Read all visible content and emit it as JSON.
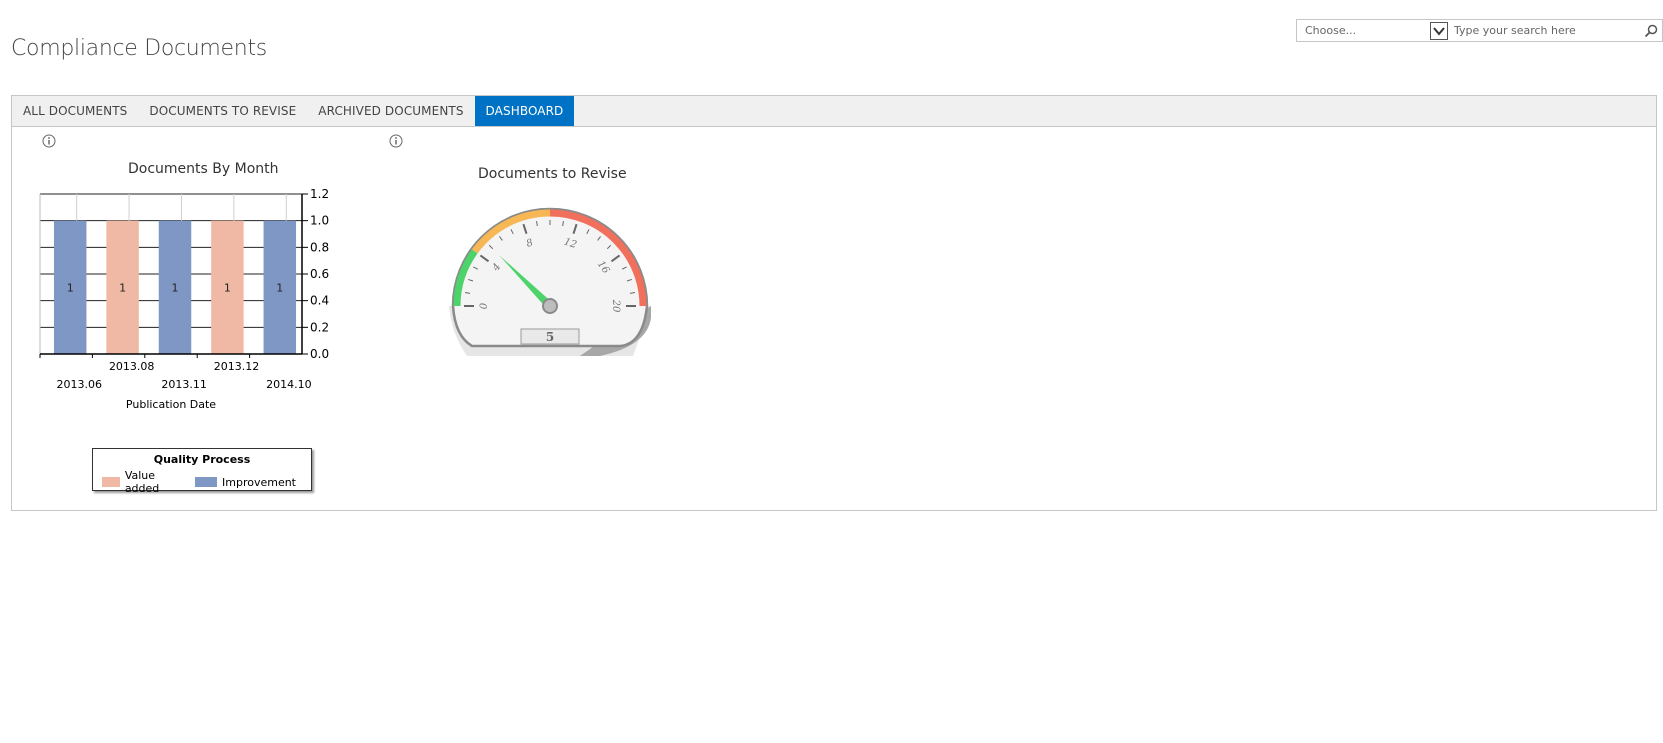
{
  "page": {
    "title": "Compliance Documents"
  },
  "search": {
    "scope_value": "Choose...",
    "placeholder": "Type your search here"
  },
  "tabs": [
    {
      "label": "ALL DOCUMENTS",
      "active": false
    },
    {
      "label": "DOCUMENTS TO REVISE",
      "active": false
    },
    {
      "label": "ARCHIVED DOCUMENTS",
      "active": false
    },
    {
      "label": "DASHBOARD",
      "active": true
    }
  ],
  "colors": {
    "accent": "#0072c6",
    "improvement": "#7f97c4",
    "value_added": "#f0b9a5",
    "gauge_green": "#4cd36a",
    "gauge_orange": "#f7b755",
    "gauge_red": "#f0705c"
  },
  "icons": {
    "scope_dropdown": "chevron-down-icon",
    "search_button": "search-icon",
    "chart_info": "info-icon"
  },
  "chart_data": [
    {
      "type": "bar",
      "title": "Documents By Month",
      "xlabel": "Publication Date",
      "ylabel": "",
      "categories": [
        "2013.06",
        "2013.08",
        "2013.11",
        "2013.12",
        "2014.10"
      ],
      "values": [
        1,
        1,
        1,
        1,
        1
      ],
      "value_labels": [
        "1",
        "1",
        "1",
        "1",
        "1"
      ],
      "series_of_bar": [
        "Improvement",
        "Value added",
        "Improvement",
        "Value added",
        "Improvement"
      ],
      "ylim": [
        0,
        1.2
      ],
      "y_ticks": [
        "0.0",
        "0.2",
        "0.4",
        "0.6",
        "0.8",
        "1.0",
        "1.2"
      ],
      "y_axis_side": "right",
      "grid": true,
      "legend": {
        "title": "Quality Process",
        "placement": "bottom",
        "entries": [
          "Value added",
          "Improvement"
        ]
      }
    },
    {
      "type": "gauge",
      "title": "Documents to Revise",
      "value": 5,
      "value_label": "5",
      "range": [
        0,
        20
      ],
      "tick_labels": [
        "0",
        "4",
        "8",
        "12",
        "16",
        "20"
      ],
      "bands": [
        {
          "from": 0,
          "to": 4,
          "color": "green"
        },
        {
          "from": 4,
          "to": 10,
          "color": "orange"
        },
        {
          "from": 10,
          "to": 20,
          "color": "red"
        }
      ]
    }
  ]
}
